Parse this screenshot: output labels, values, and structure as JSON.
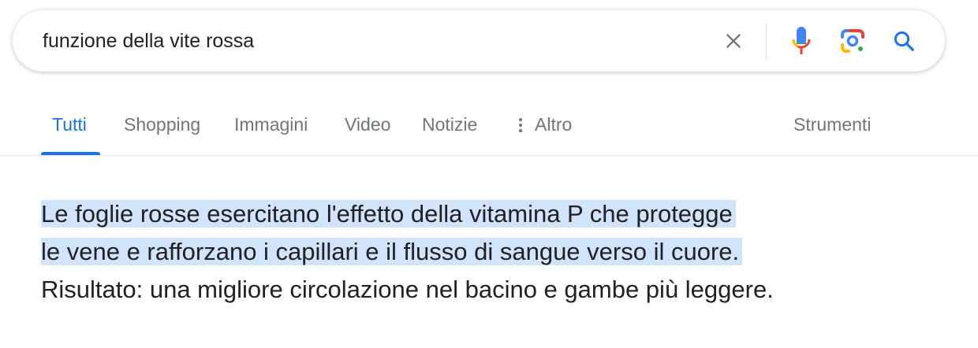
{
  "search": {
    "query": "funzione della vite rossa",
    "icons": [
      "close-icon",
      "mic-icon",
      "lens-icon",
      "search-icon"
    ]
  },
  "tabs": [
    {
      "label": "Tutti",
      "active": true
    },
    {
      "label": "Shopping",
      "active": false
    },
    {
      "label": "Immagini",
      "active": false
    },
    {
      "label": "Video",
      "active": false
    },
    {
      "label": "Notizie",
      "active": false
    },
    {
      "label": "Altro",
      "active": false
    }
  ],
  "tools_label": "Strumenti",
  "snippet": {
    "lines": [
      {
        "text": "Le foglie rosse esercitano l'effetto della vitamina P che protegge",
        "highlighted": true
      },
      {
        "text": "le vene e rafforzano i capillari e il flusso di sangue verso il cuore.",
        "highlighted": true
      },
      {
        "text": "Risultato: una migliore circolazione nel bacino e gambe più leggere.",
        "highlighted": false
      }
    ]
  },
  "colors": {
    "accent": "#1a73e8",
    "highlight": "#d2e3fc",
    "text": "#202124",
    "muted": "#70757a"
  }
}
